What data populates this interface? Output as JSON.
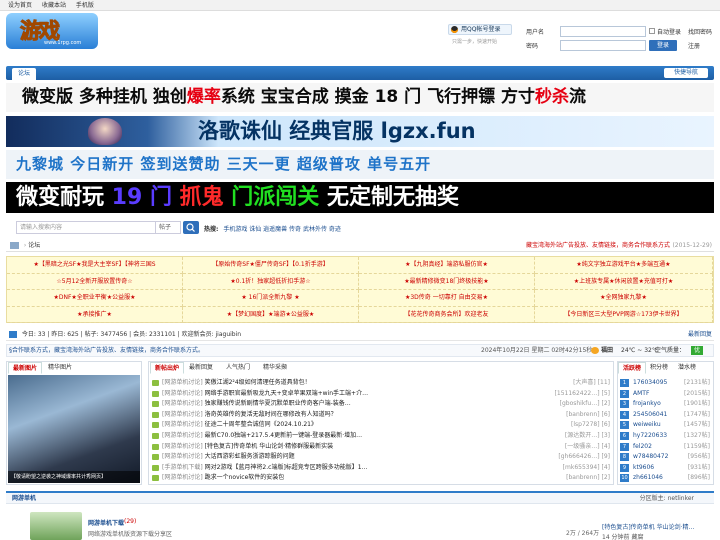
{
  "topbar": {
    "links": [
      "设为首页",
      "收藏本站",
      "手机版"
    ]
  },
  "header": {
    "logo_text": "游戏",
    "logo_url": "www.1rpg.com",
    "qq_login": "用QQ帐号登录",
    "quick_start": "只需一步，快速开始",
    "username_label": "用户名",
    "password_label": "密码",
    "auto_login": "自动登录",
    "find_password": "找回密码",
    "login_button": "登录",
    "register_button": "注册"
  },
  "nav": {
    "tab": "论坛",
    "quick_nav": "快捷导航"
  },
  "banners": {
    "b1_parts": [
      "微变版 多种挂机 独创",
      "爆率",
      "系统 宝宝合成 摸金 18 门 飞行押镖 方寸",
      "秒杀",
      "流"
    ],
    "b2": "洛歌诛仙 经典官服 lgzx.fun",
    "b3": "九黎城 今日新开 签到送赞助 三天一更 超级普攻 单号五开",
    "b4_parts": [
      "微变耐玩 ",
      "19 门 ",
      "抓鬼 ",
      "门派闯关",
      " 无定制无抽奖"
    ]
  },
  "search": {
    "placeholder": "请输入搜索内容",
    "type": "帖子",
    "hot_label": "热搜:",
    "hot_words": "手机游戏  诛仙  逍遥魔兽  传奇  武林外传  奇迹"
  },
  "breadcrumb": {
    "home": "论坛",
    "notice": "藏宝湾海外站广告投放、友情链接，商务合作联系方式",
    "date": "(2015-12-29)"
  },
  "ads": [
    "★【黑暗之光SF★我是大主宰SF】【神将三国S",
    "【原始传奇SF★僵尸传奇SF】【0.1折手游】",
    "★【九阴真经】端游私服仿官★",
    "★纯文字独立游戏平台★多端互通★",
    "☆5月12全新开服放置传奇☆",
    "★0.1折！独家超低折扣手游☆",
    "★最新精修微变18门终极技能★",
    "★上班族专属★休闲放置★充值可打★",
    "★DNF★全职业平衡★公益服★",
    "★ 16门派全新九黎 ★",
    "★3D传奇 一切靠打 自由交易★",
    "★全网独家九黎★",
    "★承接推广★",
    "★【梦幻国度】★端游★公益服★",
    "【花花传奇商务会所】欢迎老友",
    "【今日新区三大型PVP网游☆173伊卡世界】"
  ],
  "stats": {
    "today": "今日: 33",
    "yesterday": "昨日: 625",
    "posts": "帖子: 3477456",
    "members": "会员: 2331101",
    "welcome": "欢迎新会员: jiaguibin",
    "latest": "最新回复"
  },
  "notice": {
    "text": "§合作联系方式，藏宝湾海外站广告投放、友情链接，商务合作联系方式。",
    "time": "2024年10月22日 星期二 02时42分15秒",
    "weather": "福田",
    "temp": "24℃ ~ 32℃",
    "air_label": "空气质量：",
    "air": "优"
  },
  "left_panel": {
    "tabs": [
      "最新图片",
      "精华图片"
    ],
    "caption": "【敬请盼望之逆袭之神域爆率共计秀网页】"
  },
  "mid_panel": {
    "tabs": [
      "新帖出炉",
      "最新回复",
      "人气热门",
      "精华采撷"
    ],
    "rows": [
      {
        "cat": "[网游单机讨论]",
        "title": "笑傲江湖2²4级如何清理任务道具背包！",
        "author": "[大声喜]",
        "count": "[11]"
      },
      {
        "cat": "[网游单机讨论]",
        "title": "网络手游职官最新吸龙九天+变卓苹果双端+win手工端+介…",
        "author": "[151162422…]",
        "count": "[5]"
      },
      {
        "cat": "[网游单机讨论]",
        "title": "独家赚钱传说新剧情华夏沉默单职业传奇客户端-装备…",
        "author": "[gboshikfu…]",
        "count": "[2]"
      },
      {
        "cat": "[网游单机讨论]",
        "title": "洛奇英雄传的复活无敌时间在哪修改有人知道吗？",
        "author": "[banbrenn]",
        "count": "[6]"
      },
      {
        "cat": "[网游单机讨论]",
        "title": "征途二十周年整合诚信同《2024.10.21》",
        "author": "[lsp7278]",
        "count": "[6]"
      },
      {
        "cat": "[网游单机讨论]",
        "title": "最新C70.0独端+217.5.4更新前一键端-登录器最新·增加…",
        "author": "[源达数开…]",
        "count": "[3]"
      },
      {
        "cat": "[网游单机讨论]",
        "title": "[特色复古]传奇单机 华山论剑·精修群服最新实装",
        "author": "[一级骚亲…]",
        "count": "[4]"
      },
      {
        "cat": "[网游单机讨论]",
        "title": "大话西游彩虹服务浙游踪服的问题",
        "author": "[gh666426…]",
        "count": "[9]"
      },
      {
        "cat": "[手游单机下载]",
        "title": "网对2游戏【蓝月神将2.c端版]标超竞专区跨服多功能版】1…",
        "author": "[mk655394]",
        "count": "[4]"
      },
      {
        "cat": "[网游单机讨论]",
        "title": "跪求一个novice软件的安装包",
        "author": "[banbrenn]",
        "count": "[2]"
      }
    ]
  },
  "right_panel": {
    "tabs": [
      "活跃榜",
      "积分榜",
      "潜水榜"
    ],
    "rows": [
      {
        "n": "1",
        "user": "176034095",
        "score": "[2131帖]"
      },
      {
        "n": "2",
        "user": "AMTF",
        "score": "[2015帖]"
      },
      {
        "n": "3",
        "user": "frojankyo",
        "score": "[1901帖]"
      },
      {
        "n": "4",
        "user": "254506041",
        "score": "[1747帖]"
      },
      {
        "n": "5",
        "user": "weiweiku",
        "score": "[1457帖]"
      },
      {
        "n": "6",
        "user": "hy7220633",
        "score": "[1327帖]"
      },
      {
        "n": "7",
        "user": "fel202",
        "score": "[1159帖]"
      },
      {
        "n": "8",
        "user": "w78480472",
        "score": "[956帖]"
      },
      {
        "n": "9",
        "user": "kt9606",
        "score": "[931帖]"
      },
      {
        "n": "10",
        "user": "zh661046",
        "score": "[896帖]"
      }
    ]
  },
  "section": {
    "title": "网游单机",
    "moderator": "分区版主: netlinker"
  },
  "forum": {
    "name": "网游单机下载",
    "today": "(29)",
    "desc": "网络游戏单机版资源下载分享区",
    "stats": "2万 / 264万",
    "last_title": "[特色复古]传奇单机 华山论剑·精…",
    "last_time": "14 分钟前 藏腐"
  },
  "colors": {
    "accent": "#2f7cc9",
    "ad_text": "#cc0000",
    "ad_bg": "#fffbd6"
  }
}
